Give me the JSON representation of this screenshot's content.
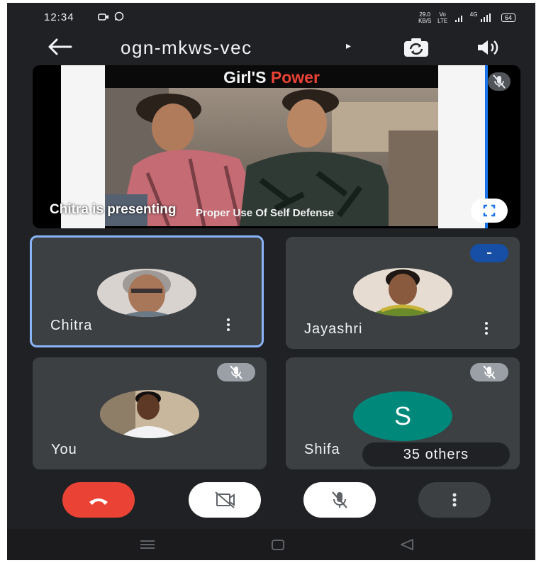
{
  "status_bar": {
    "time": "12:34",
    "left_icons": [
      "notification-icon",
      "whatsapp-icon"
    ],
    "speed_value": "29.0",
    "speed_unit": "KB/S",
    "volte_top": "Vo",
    "volte_bottom": "LTE",
    "network_label": "4G",
    "battery": "64"
  },
  "top_bar": {
    "meeting_code": "ogn-mkws-vec",
    "caret": "▸"
  },
  "presentation": {
    "header_part1": "Girl'S",
    "header_part2": "Power",
    "subtitle": "Proper Use Of Self Defense",
    "presenting_label": "Chitra is presenting"
  },
  "participants": [
    {
      "name": "Chitra",
      "active": true
    },
    {
      "name": "Jayashri",
      "speaking": true
    },
    {
      "name": "You",
      "muted": true
    },
    {
      "name": "Shifa",
      "initial": "S",
      "muted": true
    }
  ],
  "others_label": "35 others",
  "colors": {
    "background": "#202124",
    "tile": "#3c4043",
    "active_border": "#8ab4f8",
    "end_call": "#ea4335",
    "letter_avatar": "#00897b",
    "speaking": "#174ea6"
  }
}
